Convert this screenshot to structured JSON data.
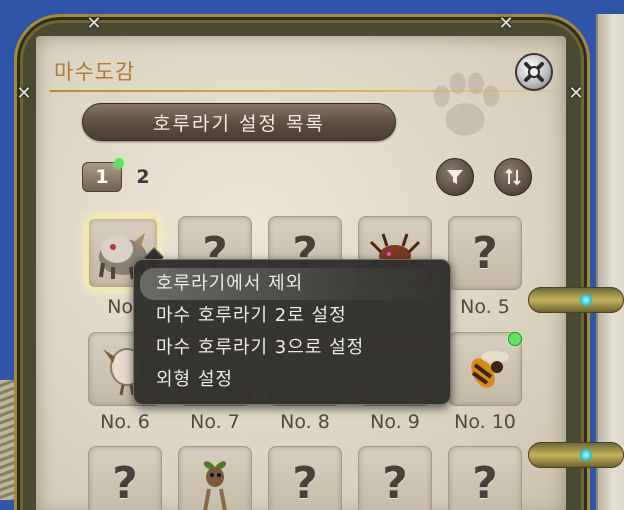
{
  "window": {
    "title": "마수도감",
    "list_button_label": "호루라기 설정 목록"
  },
  "pagination": {
    "pages": [
      "1",
      "2"
    ],
    "active_page": "1"
  },
  "toolbar": {
    "filter_icon": "filter-icon",
    "sort_icon": "sort-icon",
    "settings_icon": "settings-icon"
  },
  "grid": {
    "row1_labels": [
      "No.",
      "",
      "",
      "",
      "No. 5"
    ],
    "row2_labels": [
      "No. 6",
      "No. 7",
      "No. 8",
      "No. 9",
      "No. 10"
    ],
    "unknown_glyph": "?"
  },
  "context_menu": {
    "items": [
      "호루라기에서 제외",
      "마수 호루라기 2로 설정",
      "마수 호루라기 3으로 설정",
      "외형 설정"
    ]
  },
  "colors": {
    "accent_title": "#b07a3c",
    "new_indicator": "#62e462",
    "frame_gold": "#a08a3c",
    "gem": "#27c5d8"
  }
}
